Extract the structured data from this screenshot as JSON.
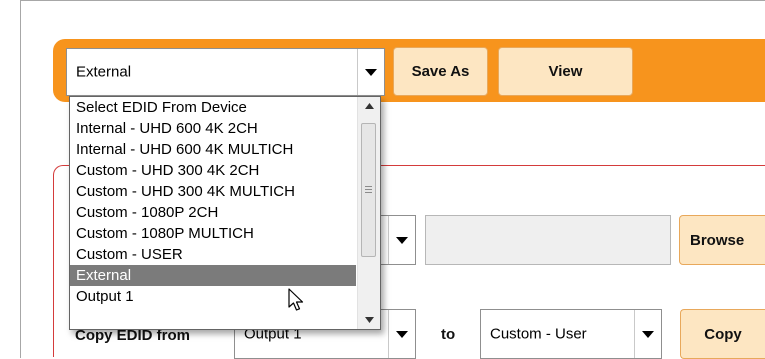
{
  "toolbar": {
    "edid_select_value": "External",
    "save_as_label": "Save As",
    "view_label": "View"
  },
  "dropdown": {
    "items": [
      "Select EDID From Device",
      "Internal - UHD 600 4K 2CH",
      "Internal - UHD 600 4K MULTICH",
      "Custom - UHD 300 4K 2CH",
      "Custom - UHD 300 4K MULTICH",
      "Custom - 1080P 2CH",
      "Custom - 1080P MULTICH",
      "Custom - USER",
      "External",
      "Output 1"
    ],
    "selected_index": 8
  },
  "upload": {
    "browse_label": "Browse"
  },
  "copy": {
    "label": "Copy EDID from",
    "source_value": "Output 1",
    "to_label": "to",
    "target_value": "Custom - User",
    "copy_label": "Copy"
  },
  "colors": {
    "accent": "#f7941d",
    "button_bg": "#fde6c2",
    "panel_border": "#d43b3b",
    "selected_item": "#7b7b7b"
  },
  "icons": [
    "chevron-down-icon",
    "scroll-up-icon",
    "scroll-down-icon",
    "mouse-pointer-icon"
  ]
}
